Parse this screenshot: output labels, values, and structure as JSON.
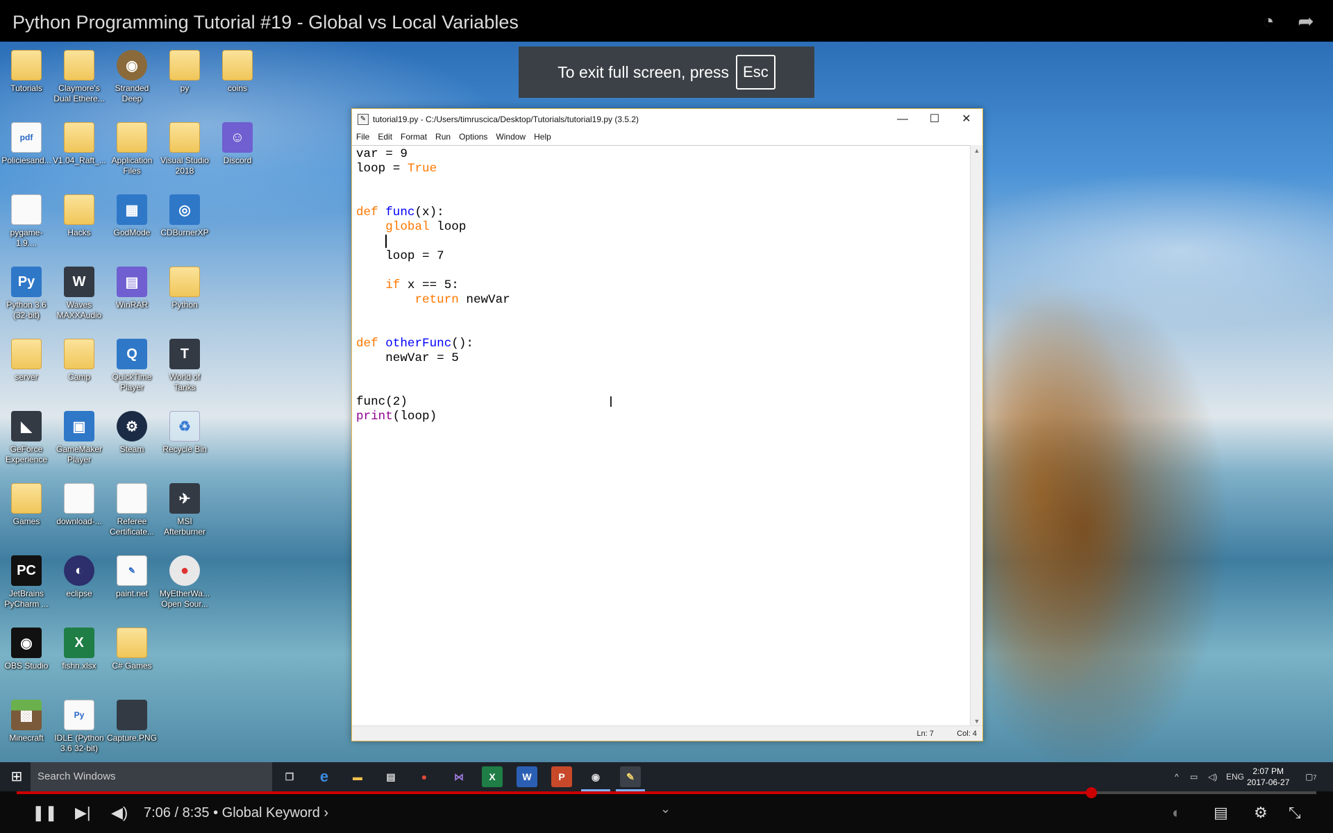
{
  "video": {
    "title": "Python Programming Tutorial #19 - Global vs Local Variables",
    "fullscreen_notice": "To exit full screen, press",
    "esc_key": "Esc",
    "player": {
      "time": "7:06 / 8:35 • Global Keyword ›",
      "progress_fraction": 0.827
    }
  },
  "desktop": {
    "icons": [
      {
        "label": "Tutorials",
        "icon": "folder-icon",
        "glyph": "",
        "col": 0,
        "row": 0,
        "style": "folder"
      },
      {
        "label": "Claymore's Dual Ethere...",
        "icon": "folder-icon",
        "glyph": "",
        "col": 1,
        "row": 0,
        "style": "folder"
      },
      {
        "label": "Stranded Deep",
        "icon": "game-icon",
        "glyph": "◉",
        "col": 2,
        "row": 0,
        "style": "brown"
      },
      {
        "label": "py",
        "icon": "folder-icon",
        "glyph": "",
        "col": 3,
        "row": 0,
        "style": "folder"
      },
      {
        "label": "coins",
        "icon": "folder-icon",
        "glyph": "",
        "col": 4,
        "row": 0,
        "style": "folder"
      },
      {
        "label": "Policiesand...",
        "icon": "pdf-icon",
        "glyph": "pdf",
        "col": 0,
        "row": 1,
        "style": "doc"
      },
      {
        "label": "V1.04_Raft_...",
        "icon": "file-icon",
        "glyph": "",
        "col": 1,
        "row": 1,
        "style": "folder"
      },
      {
        "label": "Application Files",
        "icon": "folder-icon",
        "glyph": "",
        "col": 2,
        "row": 1,
        "style": "folder"
      },
      {
        "label": "Visual Studio 2018",
        "icon": "folder-icon",
        "glyph": "",
        "col": 3,
        "row": 1,
        "style": "folder"
      },
      {
        "label": "Discord",
        "icon": "discord-icon",
        "glyph": "☺",
        "col": 4,
        "row": 1,
        "style": "purple"
      },
      {
        "label": "pygame-1.9....",
        "icon": "file-icon",
        "glyph": "",
        "col": 0,
        "row": 2,
        "style": "doc"
      },
      {
        "label": "Hacks",
        "icon": "folder-icon",
        "glyph": "",
        "col": 1,
        "row": 2,
        "style": "folder"
      },
      {
        "label": "GodMode",
        "icon": "control-panel-icon",
        "glyph": "▦",
        "col": 2,
        "row": 2,
        "style": "blue"
      },
      {
        "label": "CDBurnerXP",
        "icon": "disc-icon",
        "glyph": "◎",
        "col": 3,
        "row": 2,
        "style": "blue"
      },
      {
        "label": "Python 3.6 (32-bit)",
        "icon": "python-icon",
        "glyph": "Py",
        "col": 0,
        "row": 3,
        "style": "blue"
      },
      {
        "label": "Waves MAXXAudio",
        "icon": "waves-icon",
        "glyph": "W",
        "col": 1,
        "row": 3,
        "style": "dark"
      },
      {
        "label": "WinRAR",
        "icon": "winrar-icon",
        "glyph": "▤",
        "col": 2,
        "row": 3,
        "style": "purple"
      },
      {
        "label": "Python",
        "icon": "folder-icon",
        "glyph": "",
        "col": 3,
        "row": 3,
        "style": "folder"
      },
      {
        "label": "server",
        "icon": "folder-icon",
        "glyph": "",
        "col": 0,
        "row": 4,
        "style": "folder"
      },
      {
        "label": "Camp",
        "icon": "folder-icon",
        "glyph": "",
        "col": 1,
        "row": 4,
        "style": "folder"
      },
      {
        "label": "QuickTime Player",
        "icon": "quicktime-icon",
        "glyph": "Q",
        "col": 2,
        "row": 4,
        "style": "blue"
      },
      {
        "label": "World of Tanks",
        "icon": "tanks-icon",
        "glyph": "T",
        "col": 3,
        "row": 4,
        "style": "dark"
      },
      {
        "label": "GeForce Experience",
        "icon": "geforce-icon",
        "glyph": "◣",
        "col": 0,
        "row": 5,
        "style": "dark"
      },
      {
        "label": "GameMaker Player",
        "icon": "gamemaker-icon",
        "glyph": "▣",
        "col": 1,
        "row": 5,
        "style": "blue"
      },
      {
        "label": "Steam",
        "icon": "steam-icon",
        "glyph": "⚙",
        "col": 2,
        "row": 5,
        "style": "darkblue"
      },
      {
        "label": "Recycle Bin",
        "icon": "recycle-bin-icon",
        "glyph": "♻",
        "col": 3,
        "row": 5,
        "style": "glass"
      },
      {
        "label": "Games",
        "icon": "folder-icon",
        "glyph": "",
        "col": 0,
        "row": 6,
        "style": "folder"
      },
      {
        "label": "download-...",
        "icon": "image-file-icon",
        "glyph": "",
        "col": 1,
        "row": 6,
        "style": "doc"
      },
      {
        "label": "Referee Certificate...",
        "icon": "image-file-icon",
        "glyph": "",
        "col": 2,
        "row": 6,
        "style": "doc"
      },
      {
        "label": "MSI Afterburner",
        "icon": "afterburner-icon",
        "glyph": "✈",
        "col": 3,
        "row": 6,
        "style": "dark"
      },
      {
        "label": "JetBrains PyCharm ...",
        "icon": "pycharm-icon",
        "glyph": "PC",
        "col": 0,
        "row": 7,
        "style": "black"
      },
      {
        "label": "eclipse",
        "icon": "eclipse-icon",
        "glyph": "◐",
        "col": 1,
        "row": 7,
        "style": "navy"
      },
      {
        "label": "paint.net",
        "icon": "paintnet-icon",
        "glyph": "✎",
        "col": 2,
        "row": 7,
        "style": "doc"
      },
      {
        "label": "MyEtherWa... Open Sour...",
        "icon": "chrome-icon",
        "glyph": "●",
        "col": 3,
        "row": 7,
        "style": "chrome"
      },
      {
        "label": "OBS Studio",
        "icon": "obs-icon",
        "glyph": "◉",
        "col": 0,
        "row": 8,
        "style": "black"
      },
      {
        "label": "fishn.xlsx",
        "icon": "excel-icon",
        "glyph": "X",
        "col": 1,
        "row": 8,
        "style": "green"
      },
      {
        "label": "C# Games",
        "icon": "folder-icon",
        "glyph": "",
        "col": 2,
        "row": 8,
        "style": "folder"
      },
      {
        "label": "Minecraft",
        "icon": "minecraft-icon",
        "glyph": "▩",
        "col": 0,
        "row": 9,
        "style": "grass"
      },
      {
        "label": "IDLE (Python 3.6 32-bit)",
        "icon": "idle-icon",
        "glyph": "Py",
        "col": 1,
        "row": 9,
        "style": "doc"
      },
      {
        "label": "Capture.PNG",
        "icon": "image-file-icon",
        "glyph": "",
        "col": 2,
        "row": 9,
        "style": "dark"
      }
    ]
  },
  "idle": {
    "title": "tutorial19.py - C:/Users/timruscica/Desktop/Tutorials/tutorial19.py (3.5.2)",
    "menu": [
      "File",
      "Edit",
      "Format",
      "Run",
      "Options",
      "Window",
      "Help"
    ],
    "status": {
      "ln": "Ln: 7",
      "col": "Col: 4"
    },
    "code": [
      "var = 9",
      "loop = True",
      "",
      "",
      "def func(x):",
      "    global loop",
      "    ",
      "    loop = 7",
      "",
      "    if x == 5:",
      "        return newVar",
      "",
      "",
      "def otherFunc():",
      "    newVar = 5",
      "",
      "",
      "func(2)",
      "print(loop)"
    ]
  },
  "taskbar": {
    "search_placeholder": "Search Windows",
    "language": "ENG",
    "time": "2:07 PM",
    "date": "2017-06-27",
    "notification_count": "7"
  },
  "colors": {
    "keyword": "#ff7700",
    "function_name": "#0000ff",
    "builtin": "#900090",
    "progress": "#cc0000"
  }
}
